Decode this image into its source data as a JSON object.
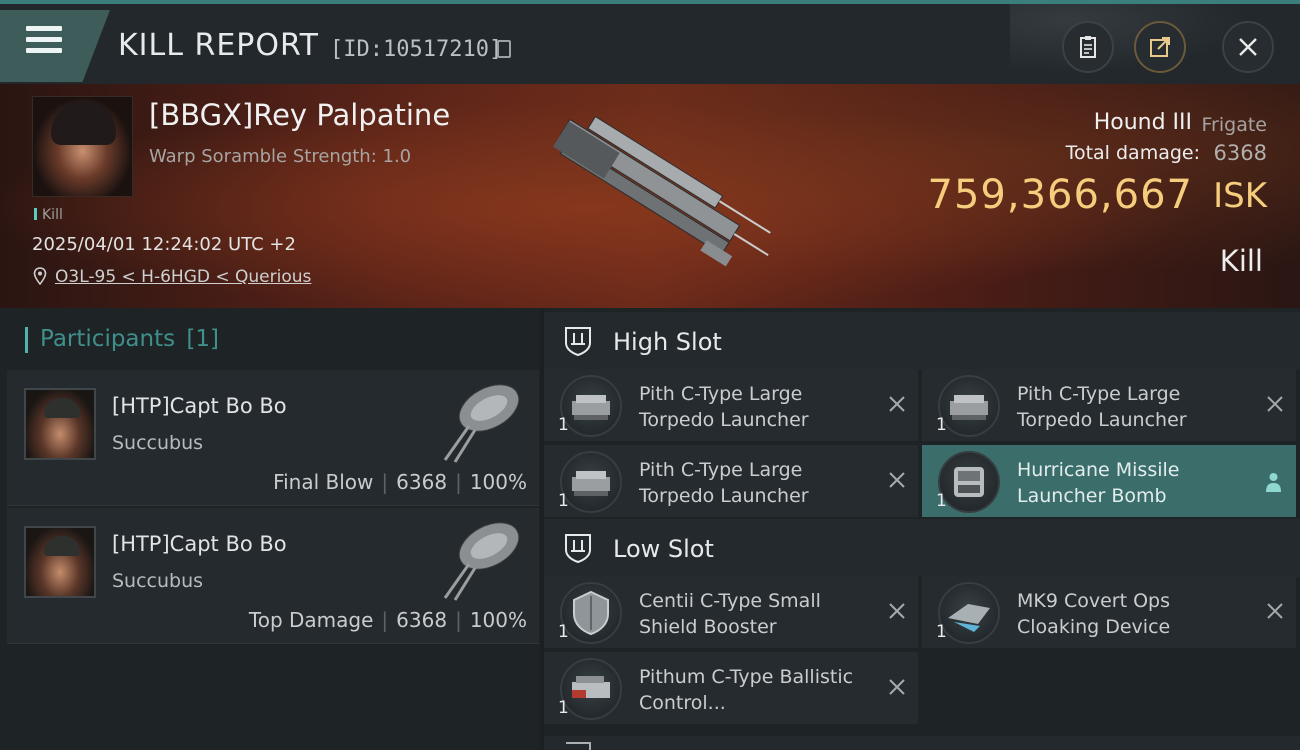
{
  "header": {
    "title": "KILL REPORT",
    "report_id": "[ID:10517210]",
    "icons": [
      "menu-icon",
      "copy-icon",
      "clipboard-icon",
      "share-icon",
      "close-icon"
    ]
  },
  "victim": {
    "name": "[BBGX]Rey Palpatine",
    "scramble": "Warp Soramble Strength: 1.0",
    "kill_tag": "Kill",
    "timestamp": "2025/04/01 12:24:02 UTC +2",
    "location": "O3L-95 < H-6HGD < Querious",
    "ship_name": "Hound III",
    "ship_class": "Frigate",
    "damage_label": "Total damage:",
    "damage_value": "6368",
    "isk_value": "759,366,667",
    "isk_unit": "ISK",
    "result": "Kill"
  },
  "participants": {
    "title": "Participants",
    "count": "[1]",
    "list": [
      {
        "name": "[HTP]Capt Bo Bo",
        "ship": "Succubus",
        "role": "Final Blow",
        "damage": "6368",
        "percent": "100%"
      },
      {
        "name": "[HTP]Capt Bo Bo",
        "ship": "Succubus",
        "role": "Top Damage",
        "damage": "6368",
        "percent": "100%"
      }
    ]
  },
  "slots": {
    "high": {
      "label": "High Slot",
      "items": [
        {
          "name": "Pith C-Type Large Torpedo Launcher",
          "qty": "1"
        },
        {
          "name": "Pith C-Type Large Torpedo Launcher",
          "qty": "1"
        },
        {
          "name": "Pith C-Type Large Torpedo Launcher",
          "qty": "1"
        },
        {
          "name": "Hurricane Missile Launcher Bomb",
          "qty": "1"
        }
      ]
    },
    "low": {
      "label": "Low Slot",
      "items": [
        {
          "name": "Centii C-Type Small Shield Booster",
          "qty": "1"
        },
        {
          "name": "MK9 Covert Ops Cloaking Device",
          "qty": "1"
        },
        {
          "name": "Pithum C-Type Ballistic Control...",
          "qty": "1"
        }
      ]
    }
  }
}
